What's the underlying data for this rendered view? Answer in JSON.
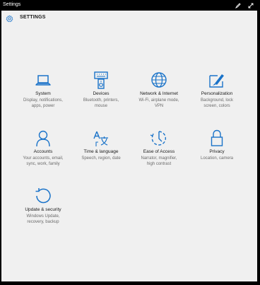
{
  "window": {
    "title": "Settings",
    "edit_icon": "pen-icon",
    "fullscreen_icon": "expand-icon"
  },
  "header": {
    "title": "SETTINGS",
    "icon": "gear-icon"
  },
  "colors": {
    "accent": "#1a73c9",
    "background": "#f0f0f0",
    "titlebar": "#000000",
    "subtitle": "#6b6b6b"
  },
  "categories": [
    {
      "name": "System",
      "desc1": "Display, notifications,",
      "desc2": "apps, power",
      "icon": "laptop-icon"
    },
    {
      "name": "Devices",
      "desc1": "Bluetooth, printers,",
      "desc2": "mouse",
      "icon": "keyboard-speaker-icon"
    },
    {
      "name": "Network & Internet",
      "desc1": "Wi-Fi, airplane mode,",
      "desc2": "VPN",
      "icon": "globe-icon"
    },
    {
      "name": "Personalization",
      "desc1": "Background, lock",
      "desc2": "screen, colors",
      "icon": "paint-brush-icon"
    },
    {
      "name": "Accounts",
      "desc1": "Your accounts, email,",
      "desc2": "sync, work, family",
      "icon": "person-icon"
    },
    {
      "name": "Time & language",
      "desc1": "Speech, region, date",
      "desc2": "",
      "icon": "language-icon"
    },
    {
      "name": "Ease of Access",
      "desc1": "Narrator, magnifier,",
      "desc2": "high contrast",
      "icon": "ease-of-access-icon"
    },
    {
      "name": "Privacy",
      "desc1": "Location, camera",
      "desc2": "",
      "icon": "lock-icon"
    },
    {
      "name": "Update & security",
      "desc1": "Windows Update,",
      "desc2": "recovery, backup",
      "icon": "refresh-icon"
    }
  ]
}
